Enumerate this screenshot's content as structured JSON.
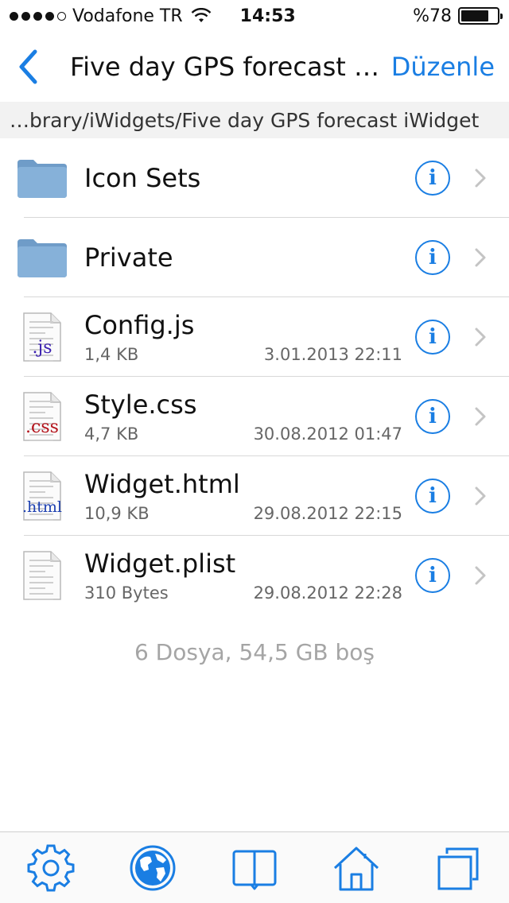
{
  "status_bar": {
    "carrier": "Vodafone TR",
    "time": "14:53",
    "battery_text": "%78",
    "battery_level": 0.78
  },
  "nav": {
    "title": "Five day GPS  forecast iWidget",
    "edit_label": "Düzenle"
  },
  "path": "…brary/iWidgets/Five day GPS  forecast iWidget",
  "files": [
    {
      "name": "Icon Sets",
      "type": "folder",
      "size": "",
      "date": "",
      "icon": "folder-icon"
    },
    {
      "name": "Private",
      "type": "folder",
      "size": "",
      "date": "",
      "icon": "folder-icon"
    },
    {
      "name": "Config.js",
      "type": "file",
      "size": "1,4 KB",
      "date": "3.01.2013 22:11",
      "icon": "js-file-icon",
      "badge": ".js",
      "badge_color": "#3a1fb0"
    },
    {
      "name": "Style.css",
      "type": "file",
      "size": "4,7 KB",
      "date": "30.08.2012 01:47",
      "icon": "css-file-icon",
      "badge": ".css",
      "badge_color": "#b4121a"
    },
    {
      "name": "Widget.html",
      "type": "file",
      "size": "10,9 KB",
      "date": "29.08.2012 22:15",
      "icon": "html-file-icon",
      "badge": ".html",
      "badge_color": "#1c3fb0"
    },
    {
      "name": "Widget.plist",
      "type": "file",
      "size": "310 Bytes",
      "date": "29.08.2012 22:28",
      "icon": "plist-file-icon",
      "badge": "",
      "badge_color": "#888888"
    }
  ],
  "summary": "6 Dosya, 54,5 GB boş",
  "colors": {
    "accent": "#1a7ee3",
    "folder": "#86b1d9"
  },
  "tabs": [
    {
      "name": "tab-settings",
      "icon": "gear-icon"
    },
    {
      "name": "tab-web",
      "icon": "globe-icon"
    },
    {
      "name": "tab-bookmarks",
      "icon": "book-icon"
    },
    {
      "name": "tab-home",
      "icon": "home-icon"
    },
    {
      "name": "tab-windows",
      "icon": "windows-icon"
    }
  ]
}
